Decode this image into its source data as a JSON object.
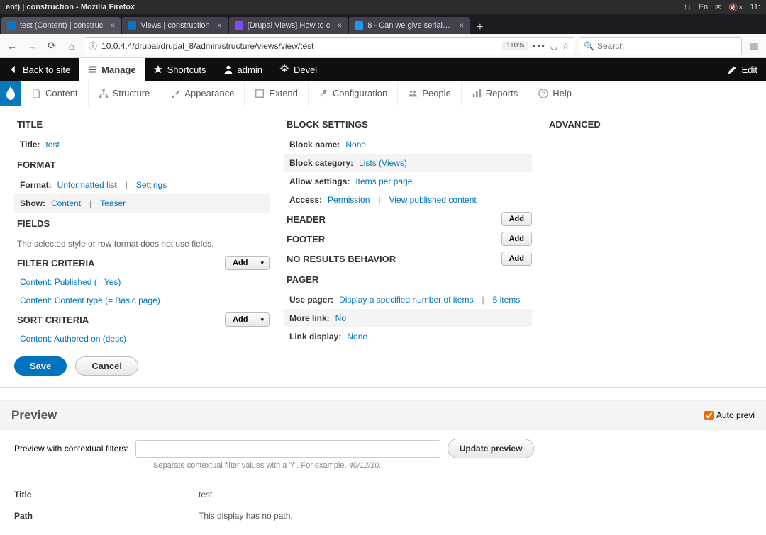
{
  "os": {
    "title": "ent) | construction - Mozilla Firefox",
    "time": "11:"
  },
  "ff": {
    "tabs": [
      {
        "label": "test (Content) | construc",
        "active": true
      },
      {
        "label": "Views | construction",
        "active": false
      },
      {
        "label": "[Drupal Views] How to c",
        "active": false
      },
      {
        "label": "8 - Can we give serial nu",
        "active": false
      }
    ],
    "url": "10.0.4.4/drupal/drupal_8/admin/structure/views/view/test",
    "zoom": "110%",
    "search_placeholder": "Search"
  },
  "drupal_bar": {
    "back": "Back to site",
    "manage": "Manage",
    "shortcuts": "Shortcuts",
    "user": "admin",
    "devel": "Devel",
    "edit": "Edit"
  },
  "admin_menu": {
    "items": [
      "Content",
      "Structure",
      "Appearance",
      "Extend",
      "Configuration",
      "People",
      "Reports",
      "Help"
    ]
  },
  "views": {
    "title_section": "TITLE",
    "title_label": "Title:",
    "title_value": "test",
    "format_section": "FORMAT",
    "format_label": "Format:",
    "format_value": "Unformatted list",
    "settings": "Settings",
    "show_label": "Show:",
    "show_value": "Content",
    "teaser": "Teaser",
    "fields_section": "FIELDS",
    "fields_helper": "The selected style or row format does not use fields.",
    "filter_section": "FILTER CRITERIA",
    "add": "Add",
    "filter1": "Content: Published (= Yes)",
    "filter2": "Content: Content type (= Basic page)",
    "sort_section": "SORT CRITERIA",
    "sort1": "Content: Authored on (desc)",
    "block_section": "BLOCK SETTINGS",
    "block_name_label": "Block name:",
    "block_name_value": "None",
    "block_cat_label": "Block category:",
    "block_cat_value": "Lists (Views)",
    "allow_label": "Allow settings:",
    "allow_value": "Items per page",
    "access_label": "Access:",
    "access_value": "Permission",
    "access_value2": "View published content",
    "header_section": "HEADER",
    "footer_section": "FOOTER",
    "noresults_section": "NO RESULTS BEHAVIOR",
    "pager_section": "PAGER",
    "pager_label": "Use pager:",
    "pager_value": "Display a specified number of items",
    "pager_items": "5 items",
    "more_label": "More link:",
    "more_value": "No",
    "linkdisplay_label": "Link display:",
    "linkdisplay_value": "None",
    "advanced": "ADVANCED"
  },
  "actions": {
    "save": "Save",
    "cancel": "Cancel"
  },
  "preview": {
    "title": "Preview",
    "auto": "Auto previ",
    "filter_label": "Preview with contextual filters:",
    "update": "Update preview",
    "hint_pre": "Separate contextual filter values with a \"/\". For example, ",
    "hint_em": "40/12/10.",
    "t_title_label": "Title",
    "t_title_value": "test",
    "t_path_label": "Path",
    "t_path_value": "This display has no path."
  }
}
